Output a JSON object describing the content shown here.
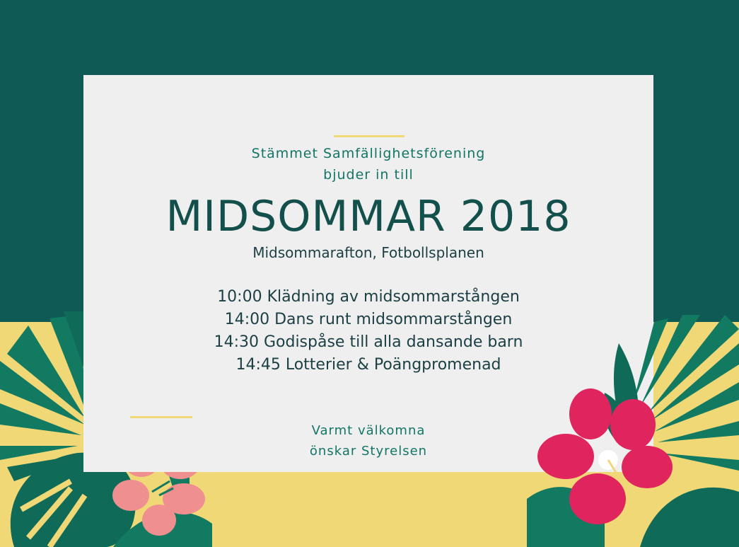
{
  "invitation": {
    "org_line1": "Stämmet Samfällighetsförening",
    "org_line2": "bjuder in till",
    "title": "MIDSOMMAR 2018",
    "subtitle": "Midsommarafton, Fotbollsplanen",
    "schedule": [
      "10:00 Klädning av midsommarstången",
      "14:00 Dans runt midsommarstången",
      "14:30 Godispåse till alla dansande barn",
      "14:45 Lotterier & Poängpromenad"
    ],
    "closing_line1": "Varmt välkomna",
    "closing_line2": "önskar Styrelsen"
  },
  "colors": {
    "dark_green": "#0f5a54",
    "yellow": "#f0d877",
    "card": "#efefef",
    "magenta_flower": "#e0245e",
    "pink_flower": "#ef8f8f",
    "leaf_green": "#137a62"
  }
}
